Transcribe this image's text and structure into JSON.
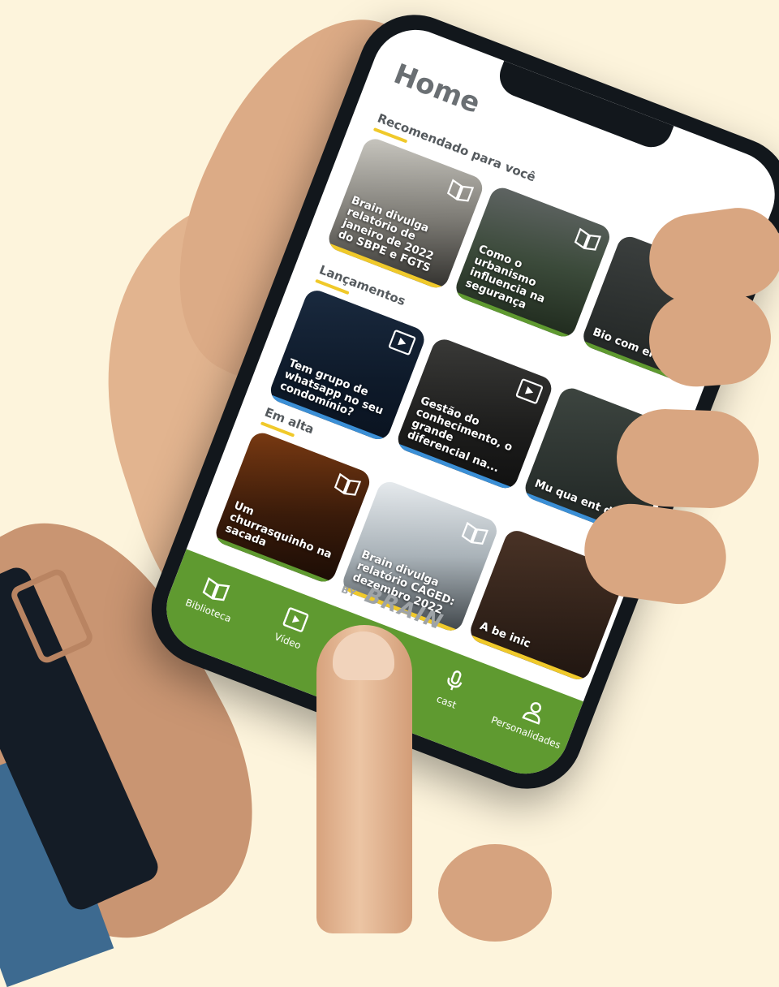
{
  "app": {
    "title": "Home",
    "brand_by": "BY",
    "brand_name": "BRAIN",
    "accent_color": "#5f9a30",
    "underline_color": "#f0c92a"
  },
  "header": {
    "search_icon": "search-icon",
    "menu_icon": "menu-icon"
  },
  "sections": [
    {
      "title": "Recomendado para você",
      "cards": [
        {
          "title": "Brain divulga relatório de janeiro de 2022 do SBPE e FGTS",
          "icon": "book-icon"
        },
        {
          "title": "Como o urbanismo influencia na segurança",
          "icon": "book-icon"
        },
        {
          "title": "Bio com em esc",
          "icon": "book-icon"
        }
      ]
    },
    {
      "title": "Lançamentos",
      "cards": [
        {
          "title": "Tem grupo de whatsapp no seu condomínio?",
          "icon": "video-icon"
        },
        {
          "title": "Gestão do conhecimento, o grande diferencial na...",
          "icon": "video-icon"
        },
        {
          "title": "Mu qua ent des",
          "icon": "video-icon"
        }
      ]
    },
    {
      "title": "Em alta",
      "cards": [
        {
          "title": "Um churrasquinho na sacada",
          "icon": "book-icon"
        },
        {
          "title": "Brain divulga relatório CAGED: dezembro 2022",
          "icon": "book-icon"
        },
        {
          "title": "A be inic",
          "icon": "book-icon"
        }
      ]
    }
  ],
  "bottom_nav": [
    {
      "label": "Biblioteca",
      "icon": "book-icon"
    },
    {
      "label": "Vídeo",
      "icon": "video-icon"
    },
    {
      "label": "",
      "icon": "home-icon"
    },
    {
      "label": "cast",
      "icon": "microphone-icon"
    },
    {
      "label": "Personalidades",
      "icon": "person-icon"
    }
  ]
}
